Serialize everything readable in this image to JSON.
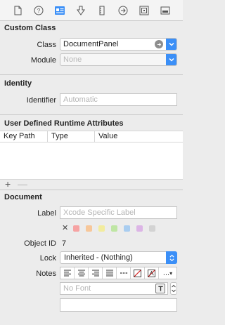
{
  "toolbar": {
    "icons": [
      "file-icon",
      "help-icon",
      "identity-icon",
      "attributes-icon",
      "size-icon",
      "connections-icon",
      "bindings-icon",
      "effects-icon"
    ]
  },
  "custom_class": {
    "title": "Custom Class",
    "class_label": "Class",
    "class_value": "DocumentPanel",
    "module_label": "Module",
    "module_placeholder": "None"
  },
  "identity": {
    "title": "Identity",
    "identifier_label": "Identifier",
    "identifier_placeholder": "Automatic"
  },
  "runtime_attributes": {
    "title": "User Defined Runtime Attributes",
    "columns": [
      "Key Path",
      "Type",
      "Value"
    ],
    "add_label": "+",
    "remove_label": "—"
  },
  "document": {
    "title": "Document",
    "label_label": "Label",
    "label_placeholder": "Xcode Specific Label",
    "clear_label": "✕",
    "swatch_colors": [
      "#f6a3a3",
      "#f7c79a",
      "#f2ec9e",
      "#bfe6a4",
      "#a9cdf0",
      "#dcb5e6",
      "#d3d3d3"
    ],
    "object_id_label": "Object ID",
    "object_id_value": "7",
    "lock_label": "Lock",
    "lock_value": "Inherited - (Nothing)",
    "notes_label": "Notes",
    "font_placeholder": "No Font",
    "more_label": "..."
  },
  "colors": {
    "accent": "#3b8ff7"
  }
}
